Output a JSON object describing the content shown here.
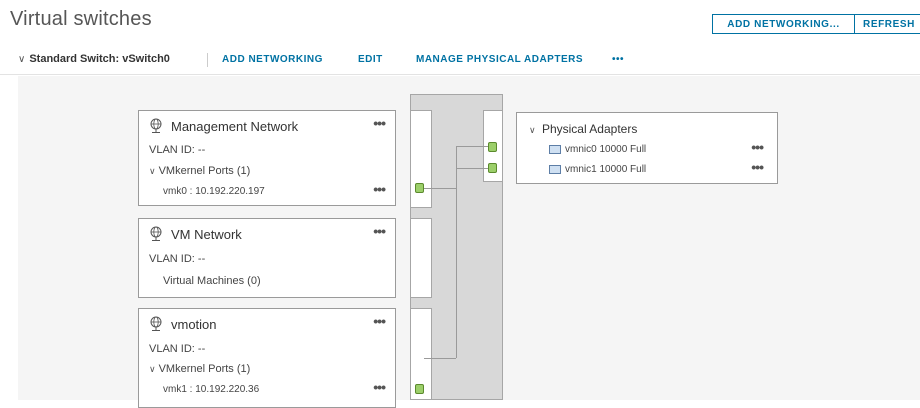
{
  "page": {
    "title": "Virtual switches"
  },
  "top_actions": {
    "add_networking": "ADD NETWORKING...",
    "refresh": "REFRESH"
  },
  "switch": {
    "title": "Standard Switch: vSwitch0",
    "actions": {
      "add_networking": "ADD NETWORKING",
      "edit": "EDIT",
      "manage_adapters": "MANAGE PHYSICAL ADAPTERS",
      "more": "•••"
    }
  },
  "port_groups": [
    {
      "name": "Management Network",
      "vlan": "VLAN ID: --",
      "sub_header": "VMkernel Ports (1)",
      "sub_item": "vmk0 : 10.192.220.197",
      "more": "•••"
    },
    {
      "name": "VM Network",
      "vlan": "VLAN ID: --",
      "sub_header": "Virtual Machines (0)",
      "more": "•••"
    },
    {
      "name": "vmotion",
      "vlan": "VLAN ID: --",
      "sub_header": "VMkernel Ports (1)",
      "sub_item": "vmk1 : 10.192.220.36",
      "more": "•••"
    }
  ],
  "physical_adapters": {
    "title": "Physical Adapters",
    "items": [
      {
        "label": "vmnic0 10000 Full",
        "more": "•••"
      },
      {
        "label": "vmnic1 10000 Full",
        "more": "•••"
      }
    ]
  },
  "colors": {
    "accent": "#0072a3",
    "port_green": "#9ccf6a",
    "diagram_bg": "#f5f5f5"
  },
  "icons": {
    "port_group": "globe-network-icon",
    "nic": "network-adapter-icon",
    "expand": "chevron-down-icon"
  }
}
